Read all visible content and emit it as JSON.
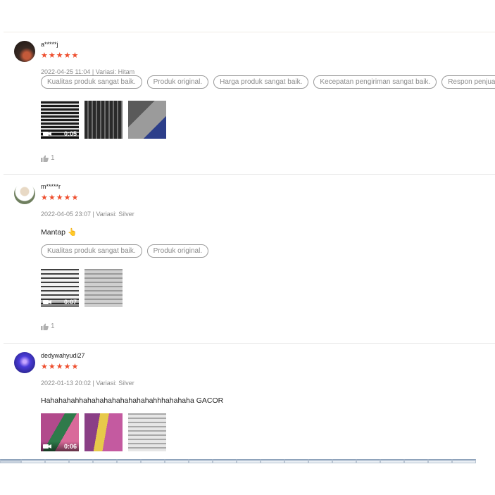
{
  "reviews": [
    {
      "username": "a*****j",
      "stars": "★★★★★",
      "meta": "2022-04-25 11:04 | Variasi: Hitam",
      "comment": "",
      "tags": [
        "Kualitas produk sangat baik.",
        "Produk original.",
        "Harga produk sangat baik.",
        "Kecepatan pengiriman sangat baik.",
        "Respon penjual"
      ],
      "video_duration": "0:05",
      "likes": "1"
    },
    {
      "username": "m*****r",
      "stars": "★★★★★",
      "meta": "2022-04-05 23:07 | Variasi: Silver",
      "comment": "Mantap 👆",
      "tags": [
        "Kualitas produk sangat baik.",
        "Produk original."
      ],
      "video_duration": "0:07",
      "likes": "1"
    },
    {
      "username": "dedywahyudi27",
      "stars": "★★★★★",
      "meta": "2022-01-13 20:02 | Variasi: Silver",
      "comment": "Hahahahahhahahahahahahahahahhhahahaha GACOR",
      "tags": [],
      "video_duration": "0:06",
      "likes": ""
    }
  ],
  "icons": {
    "star": "star-icon",
    "like": "thumbs-up-icon",
    "video": "video-camera-icon"
  },
  "colors": {
    "star": "#ee4d2d",
    "tag_border": "#9a9a9a",
    "meta_text": "#8a8a8a"
  }
}
